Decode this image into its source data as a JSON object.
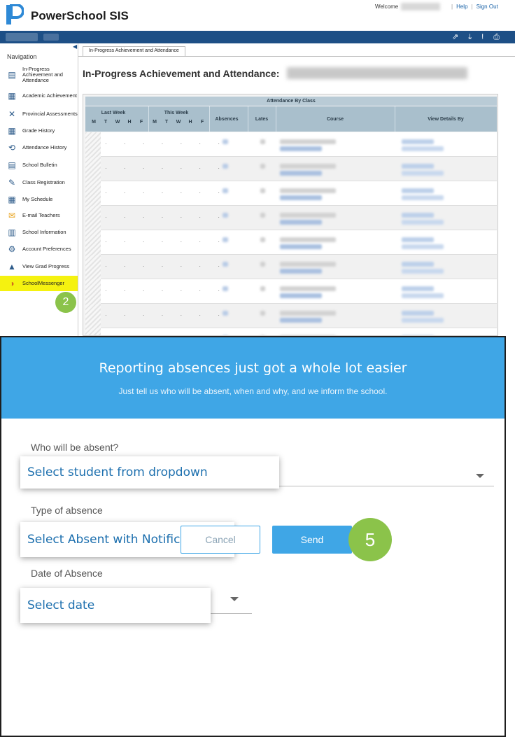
{
  "powerschool": {
    "brand": "PowerSchool SIS",
    "welcome": "Welcome",
    "help": "Help",
    "sign_out": "Sign Out",
    "nav_title": "Navigation",
    "nav_items": [
      {
        "label": "In-Progress Achievement and Attendance",
        "icon": "grade-book-icon"
      },
      {
        "label": "Academic Achievement",
        "icon": "report-icon"
      },
      {
        "label": "Provincial Assessments",
        "icon": "assessment-icon"
      },
      {
        "label": "Grade History",
        "icon": "history-icon"
      },
      {
        "label": "Attendance History",
        "icon": "attendance-icon"
      },
      {
        "label": "School Bulletin",
        "icon": "bulletin-icon"
      },
      {
        "label": "Class Registration",
        "icon": "registration-icon"
      },
      {
        "label": "My Schedule",
        "icon": "calendar-icon"
      },
      {
        "label": "E-mail Teachers",
        "icon": "envelope-icon"
      },
      {
        "label": "School Information",
        "icon": "school-icon"
      },
      {
        "label": "Account Preferences",
        "icon": "preferences-icon"
      },
      {
        "label": "View Grad Progress",
        "icon": "graduation-cap-icon"
      },
      {
        "label": "SchoolMessenger",
        "icon": "schoolmessenger-icon"
      }
    ],
    "step_badge": "2",
    "tab_label": "In-Progress Achievement and Attendance",
    "page_title": "In-Progress Achievement and Attendance:",
    "table": {
      "caption": "Attendance By Class",
      "last_week": "Last Week",
      "this_week": "This Week",
      "days": [
        "M",
        "T",
        "W",
        "H",
        "F",
        "M",
        "T",
        "W",
        "H",
        "F"
      ],
      "absences": "Absences",
      "lates": "Lates",
      "course": "Course",
      "view_details": "View Details By"
    }
  },
  "messenger": {
    "title": "Reporting absences just got a whole lot easier",
    "subtitle": "Just tell us who will be absent, when and why, and we inform the school.",
    "who_label": "Who will be absent?",
    "who_value": "Select student from dropdown",
    "type_label": "Type of absence",
    "type_value": "Select Absent with Notification",
    "date_label": "Date of Absence",
    "date_value": "Select date",
    "cancel": "Cancel",
    "send": "Send",
    "step_badge": "5"
  },
  "colors": {
    "ps_blue": "#1d4f86",
    "sm_blue": "#3fa6e6",
    "highlight_yellow": "#f5f210",
    "badge_green": "#8bc34a"
  }
}
